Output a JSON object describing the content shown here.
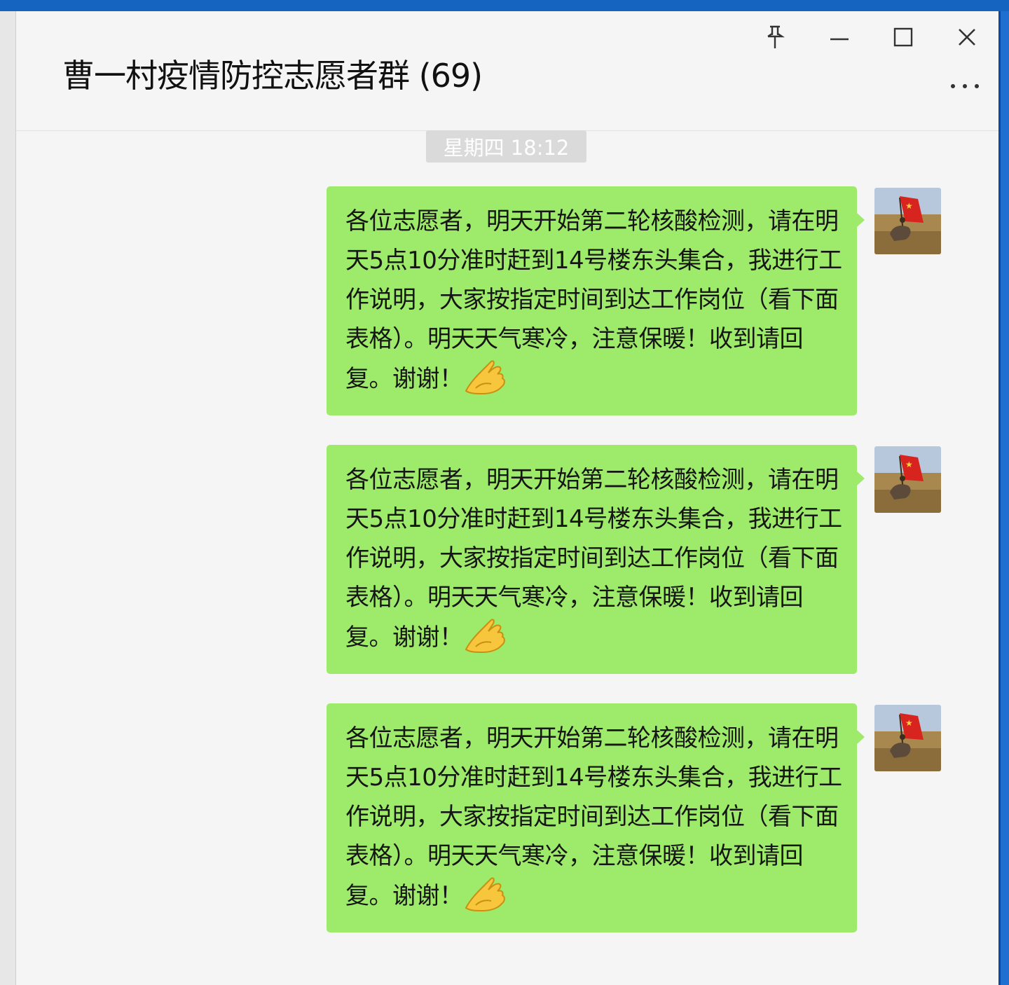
{
  "window": {
    "title": "曹一村疫情防控志愿者群 (69)",
    "controls": {
      "pin_icon": "pin-icon",
      "minimize_icon": "minimize-icon",
      "maximize_icon": "maximize-icon",
      "close_icon": "close-icon",
      "more_icon": "more-icon"
    }
  },
  "chat": {
    "timestamp": "星期四 18:12",
    "messages": [
      {
        "text": "各位志愿者，明天开始第二轮核酸检测，请在明天5点10分准时赶到14号楼东头集合，我进行工作说明，大家按指定时间到达工作岗位（看下面表格）。明天天气寒冷，注意保暖！收到请回复。谢谢！",
        "emoji": "ok-hand-emoji",
        "avatar": "flag-rider-avatar"
      },
      {
        "text": "各位志愿者，明天开始第二轮核酸检测，请在明天5点10分准时赶到14号楼东头集合，我进行工作说明，大家按指定时间到达工作岗位（看下面表格）。明天天气寒冷，注意保暖！收到请回复。谢谢！",
        "emoji": "ok-hand-emoji",
        "avatar": "flag-rider-avatar"
      },
      {
        "text": "各位志愿者，明天开始第二轮核酸检测，请在明天5点10分准时赶到14号楼东头集合，我进行工作说明，大家按指定时间到达工作岗位（看下面表格）。明天天气寒冷，注意保暖！收到请回复。谢谢！",
        "emoji": "ok-hand-emoji",
        "avatar": "flag-rider-avatar"
      }
    ]
  },
  "colors": {
    "bubble": "#9eea6a",
    "window_bg": "#f5f5f5",
    "timestamp_bg": "#dadada",
    "desktop_blue": "#1f6fd0"
  }
}
